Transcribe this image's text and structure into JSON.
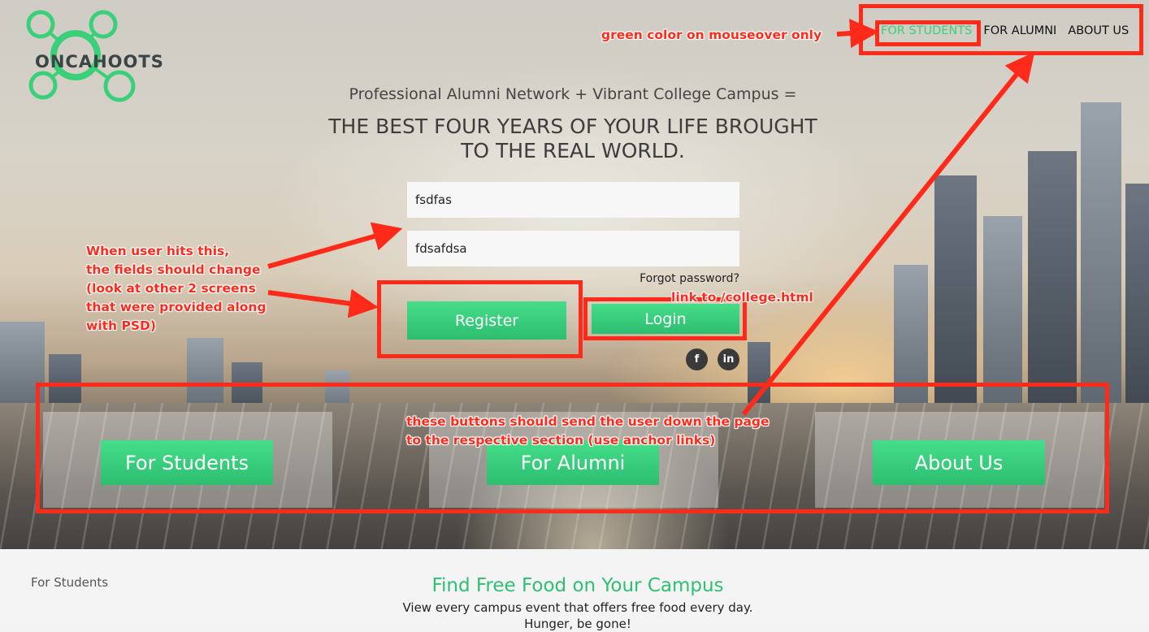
{
  "brand": {
    "name": "ONCAHOOTS",
    "accent_color": "#3ad07a",
    "annotation_color": "#ff2a1a"
  },
  "nav": {
    "items": [
      {
        "label": "FOR STUDENTS",
        "active": true
      },
      {
        "label": "FOR ALUMNI",
        "active": false
      },
      {
        "label": "ABOUT US",
        "active": false
      }
    ]
  },
  "hero": {
    "tagline": "Professional Alumni Network + Vibrant College Campus =",
    "headline_line1": "THE BEST FOUR YEARS OF YOUR LIFE BROUGHT",
    "headline_line2": "TO THE REAL WORLD."
  },
  "form": {
    "field1_value": "fsdfas",
    "field2_value": "fdsafdsa",
    "forgot_label": "Forgot password?",
    "register_label": "Register",
    "login_label": "Login"
  },
  "social": {
    "facebook_icon": "f",
    "linkedin_icon": "in"
  },
  "sections": {
    "students_label": "For Students",
    "alumni_label": "For Alumni",
    "about_label": "About Us"
  },
  "annotations": {
    "nav_note": "green color on mouseover only",
    "register_note": [
      "When user hits this,",
      "the fields should change",
      "(look at other 2 screens",
      "that were provided along",
      "with PSD)"
    ],
    "login_note": "link to /college.html",
    "sections_note": [
      "these buttons should send the user down the page",
      "to the respective section (use anchor links)"
    ]
  },
  "below_fold": {
    "left_label": "For Students",
    "title": "Find Free Food on Your Campus",
    "subtitle": "View every campus event that offers free food every day.",
    "subtitle2": "Hunger, be gone!"
  }
}
